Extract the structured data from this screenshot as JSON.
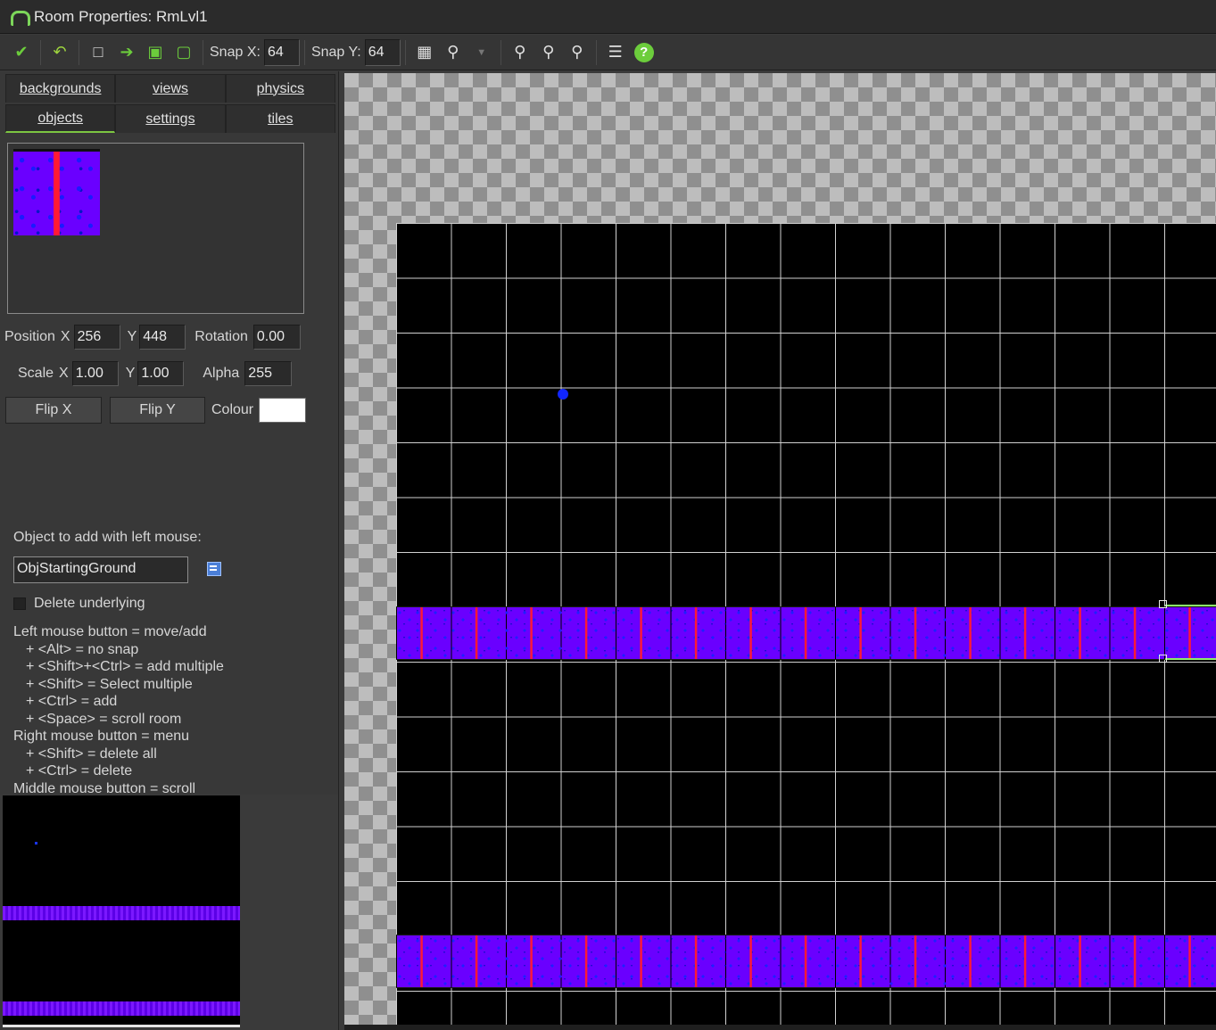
{
  "window": {
    "title": "Room Properties: RmLvl1"
  },
  "toolbar": {
    "snap_x_label": "Snap X:",
    "snap_x_value": "64",
    "snap_y_label": "Snap Y:",
    "snap_y_value": "64",
    "icons": [
      "checkmark-icon",
      "undo-icon",
      "new-document-icon",
      "arrow-right-icon",
      "lock-icon",
      "unlock-icon",
      "grid-icon",
      "magnifier-icon",
      "dropdown-arrow-icon",
      "zoom-out-icon",
      "zoom-reset-icon",
      "zoom-in-icon",
      "list-icon",
      "help-icon"
    ]
  },
  "tabs": {
    "row1": [
      "backgrounds",
      "views",
      "physics"
    ],
    "row2": [
      "objects",
      "settings",
      "tiles"
    ],
    "active": "objects"
  },
  "instance": {
    "position_label": "Position",
    "x_label": "X",
    "x_value": "256",
    "y_label": "Y",
    "y_value": "448",
    "rotation_label": "Rotation",
    "rotation_value": "0.00",
    "scale_label": "Scale",
    "scale_x_value": "1.00",
    "scale_y_value": "1.00",
    "alpha_label": "Alpha",
    "alpha_value": "255",
    "flip_x_label": "Flip X",
    "flip_y_label": "Flip Y",
    "colour_label": "Colour",
    "colour_value": "#ffffff"
  },
  "object_panel": {
    "add_label": "Object to add with left mouse:",
    "object_name": "ObjStartingGround",
    "delete_underlying_label": "Delete underlying",
    "delete_underlying_checked": false
  },
  "help_lines": [
    {
      "text": "Left mouse button = move/add",
      "indent": false
    },
    {
      "text": "+ <Alt> = no snap",
      "indent": true
    },
    {
      "text": "+ <Shift>+<Ctrl> = add multiple",
      "indent": true
    },
    {
      "text": "+ <Shift> = Select multiple",
      "indent": true
    },
    {
      "text": "+ <Ctrl> = add",
      "indent": true
    },
    {
      "text": "+ <Space> = scroll room",
      "indent": true
    },
    {
      "text": "Right mouse button = menu",
      "indent": false
    },
    {
      "text": "+ <Shift> = delete all",
      "indent": true
    },
    {
      "text": "+ <Ctrl> = delete",
      "indent": true
    },
    {
      "text": "Middle mouse button = scroll",
      "indent": false
    }
  ],
  "colors": {
    "accent_green": "#7cc642",
    "tile_purple": "#6a00ff",
    "tile_red": "#ff1a33",
    "instance_blue": "#1126ff"
  }
}
